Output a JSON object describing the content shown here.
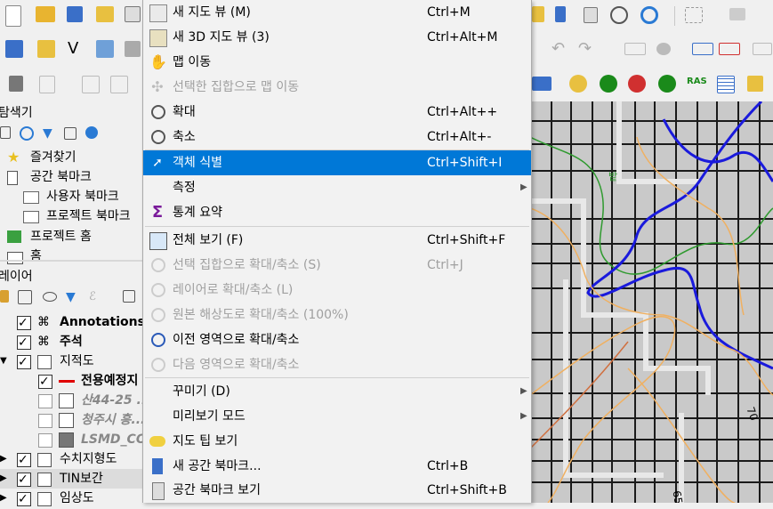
{
  "toolbar_right_badge": "RAS",
  "left": {
    "browser_title": "탐색기",
    "browser_items": [
      {
        "label": "즐겨찾기"
      },
      {
        "label": "공간 북마크"
      },
      {
        "label": "사용자 북마크"
      },
      {
        "label": "프로젝트 북마크"
      },
      {
        "label": "프로젝트 홈"
      },
      {
        "label": "홈"
      }
    ],
    "layers_title": "레이어",
    "layers": [
      {
        "label": "Annotations",
        "checked": true
      },
      {
        "label": "주석",
        "checked": true
      },
      {
        "label": "지적도",
        "checked": true
      },
      {
        "label": "전용예정지",
        "checked": true
      },
      {
        "label": "산44-25 ...",
        "checked": false
      },
      {
        "label": "청주시 흥...",
        "checked": false
      },
      {
        "label": "LSMD_CO...",
        "checked": false
      },
      {
        "label": "수치지형도",
        "checked": true
      },
      {
        "label": "TIN보간",
        "checked": true
      },
      {
        "label": "임상도",
        "checked": true
      }
    ]
  },
  "map": {
    "label_70": "70",
    "label_65": "65",
    "label_green": "밭"
  },
  "menu": {
    "items": [
      {
        "label": "새 지도 뷰 (M)",
        "shortcut": "Ctrl+M",
        "icon": "new-map-view-icon"
      },
      {
        "label": "새 3D 지도 뷰 (3)",
        "shortcut": "Ctrl+Alt+M",
        "icon": "new-3d-map-view-icon"
      },
      {
        "label": "맵 이동",
        "shortcut": "",
        "icon": "pan-hand-icon"
      },
      {
        "label": "선택한 집합으로 맵 이동",
        "shortcut": "",
        "icon": "pan-to-selection-icon"
      },
      {
        "label": "확대",
        "shortcut": "Ctrl+Alt++",
        "icon": "zoom-in-icon"
      },
      {
        "label": "축소",
        "shortcut": "Ctrl+Alt+-",
        "icon": "zoom-out-icon"
      },
      {
        "label": "객체 식별",
        "shortcut": "Ctrl+Shift+I",
        "icon": "identify-icon"
      },
      {
        "label": "측정",
        "shortcut": "",
        "icon": ""
      },
      {
        "label": "통계 요약",
        "shortcut": "",
        "icon": "sigma-icon"
      },
      {
        "label": "전체 보기 (F)",
        "shortcut": "Ctrl+Shift+F",
        "icon": "zoom-full-icon"
      },
      {
        "label": "선택 집합으로 확대/축소 (S)",
        "shortcut": "Ctrl+J",
        "icon": "zoom-selection-icon"
      },
      {
        "label": "레이어로 확대/축소 (L)",
        "shortcut": "",
        "icon": "zoom-layer-icon"
      },
      {
        "label": "원본 해상도로 확대/축소 (100%)",
        "shortcut": "",
        "icon": "zoom-native-icon"
      },
      {
        "label": "이전 영역으로 확대/축소",
        "shortcut": "",
        "icon": "zoom-last-icon"
      },
      {
        "label": "다음 영역으로 확대/축소",
        "shortcut": "",
        "icon": "zoom-next-icon"
      },
      {
        "label": "꾸미기 (D)",
        "shortcut": "",
        "icon": ""
      },
      {
        "label": "미리보기 모드",
        "shortcut": "",
        "icon": ""
      },
      {
        "label": "지도 팁 보기",
        "shortcut": "",
        "icon": "map-tips-icon"
      },
      {
        "label": "새 공간 북마크...",
        "shortcut": "Ctrl+B",
        "icon": "new-bookmark-icon"
      },
      {
        "label": "공간 북마크 보기",
        "shortcut": "Ctrl+Shift+B",
        "icon": "show-bookmarks-icon"
      }
    ]
  },
  "colors": {
    "highlight": "#0078d7",
    "menu_bg": "#f2f2f2",
    "map_bg": "#c9c9c9",
    "contour_blue": "#1a1adc",
    "contour_green": "#2e9a2e",
    "contour_orange": "#f0b060"
  }
}
